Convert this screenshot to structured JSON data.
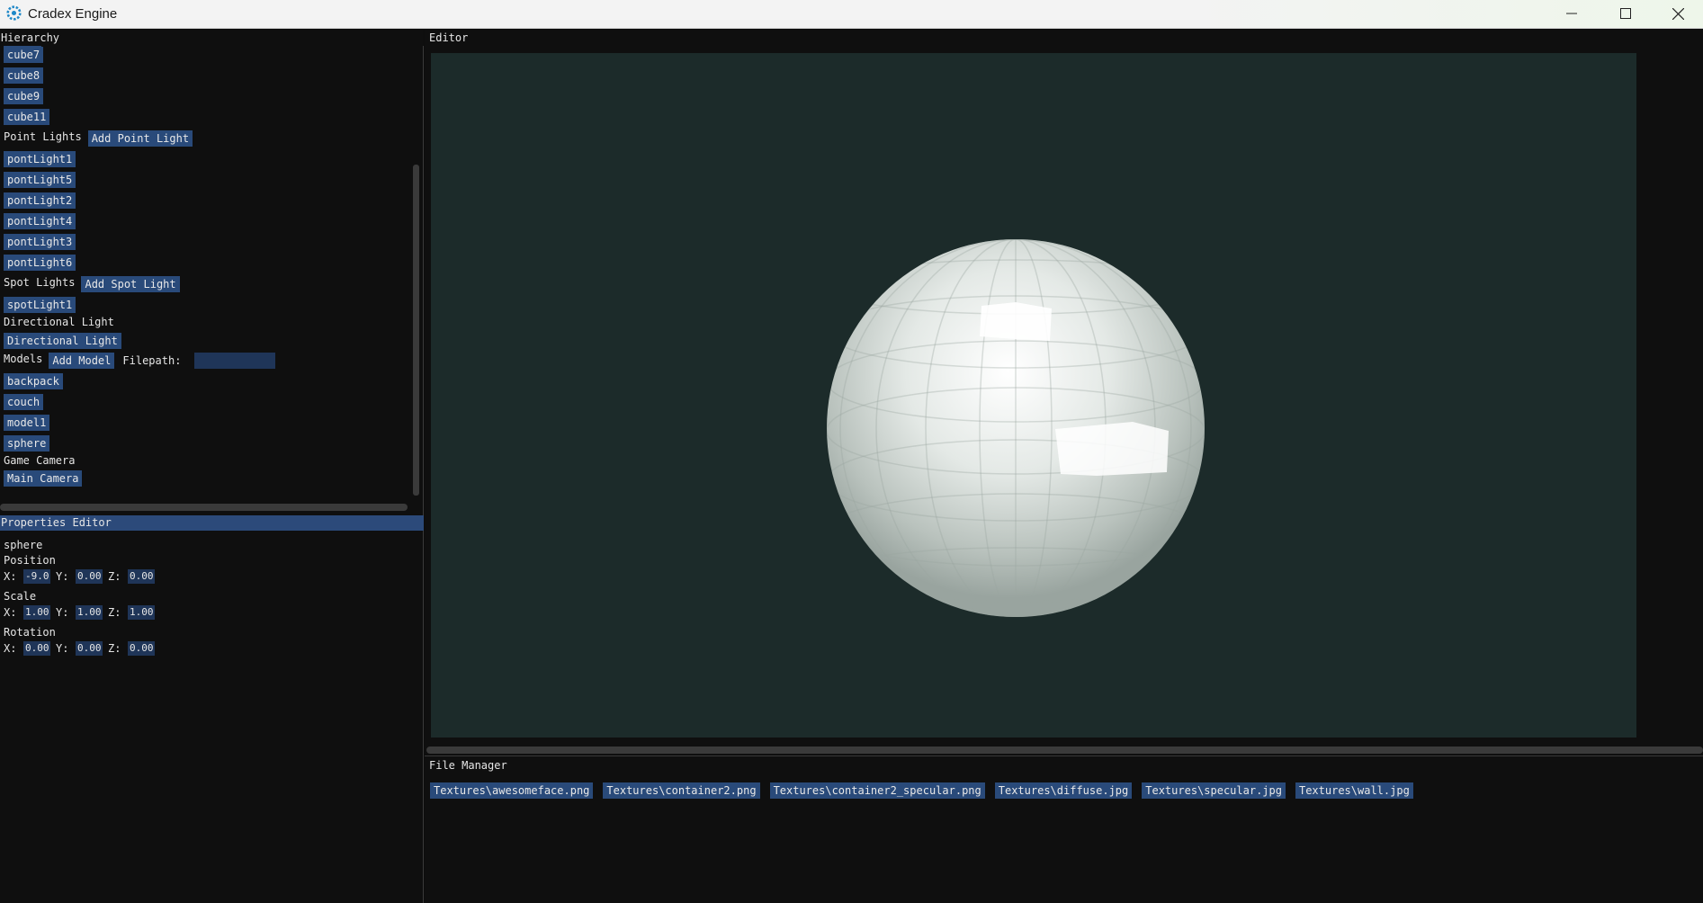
{
  "window": {
    "title": "Cradex Engine"
  },
  "hierarchy": {
    "header": "Hierarchy",
    "cubes": [
      "cube7",
      "cube8",
      "cube9",
      "cube11"
    ],
    "point_lights_label": "Point Lights",
    "add_point_light": "Add Point Light",
    "point_lights": [
      "pontLight1",
      "pontLight5",
      "pontLight2",
      "pontLight4",
      "pontLight3",
      "pontLight6"
    ],
    "spot_lights_label": "Spot Lights",
    "add_spot_light": "Add Spot Light",
    "spot_lights": [
      "spotLight1"
    ],
    "directional_label": "Directional Light",
    "directional_button": "Directional Light",
    "models_label": "Models",
    "add_model": "Add Model",
    "filepath_label": "Filepath:",
    "filepath_value": "",
    "models": [
      "backpack",
      "couch",
      "model1",
      "sphere"
    ],
    "game_camera_label": "Game Camera",
    "main_camera": "Main Camera"
  },
  "properties": {
    "header": "Properties Editor",
    "object_name": "sphere",
    "position_label": "Position",
    "scale_label": "Scale",
    "rotation_label": "Rotation",
    "x_label": "X:",
    "y_label": "Y:",
    "z_label": "Z:",
    "position": {
      "x": "-9.0",
      "y": "0.00",
      "z": "0.00"
    },
    "scale": {
      "x": "1.00",
      "y": "1.00",
      "z": "1.00"
    },
    "rotation": {
      "x": "0.00",
      "y": "0.00",
      "z": "0.00"
    }
  },
  "editor": {
    "header": "Editor"
  },
  "file_manager": {
    "header": "File Manager",
    "files": [
      "Textures\\awesomeface.png",
      "Textures\\container2.png",
      "Textures\\container2_specular.png",
      "Textures\\diffuse.jpg",
      "Textures\\specular.jpg",
      "Textures\\wall.jpg"
    ]
  },
  "colors": {
    "button": "#294a7a",
    "header_active": "#2c4a7a",
    "viewport_bg": "#1c2b2a"
  }
}
